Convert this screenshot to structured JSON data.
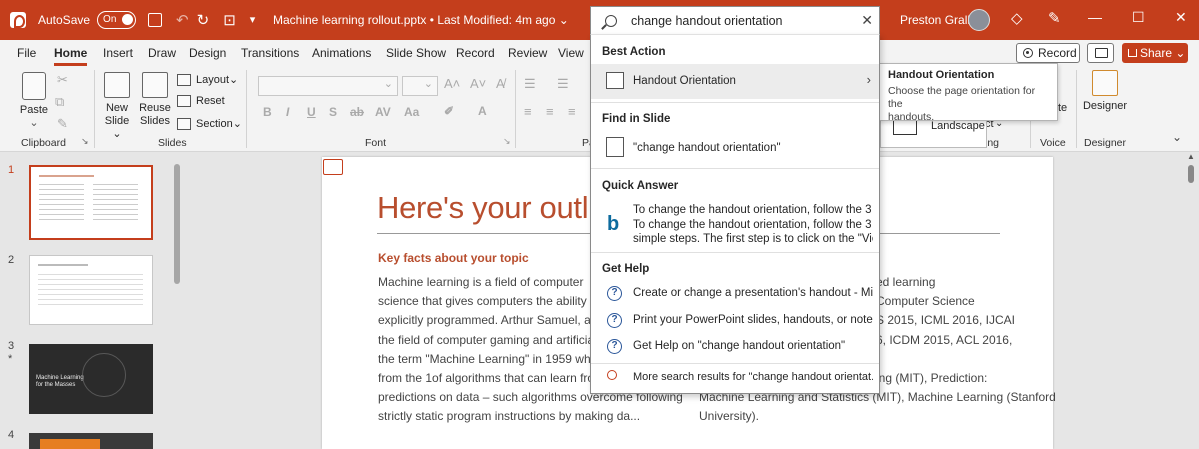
{
  "titlebar": {
    "autosave_label": "AutoSave",
    "autosave_state": "On",
    "filename": "Machine learning rollout.pptx",
    "modified": "Last Modified: 4m ago",
    "user": "Preston Gralla",
    "bg_color": "#c43e1c"
  },
  "search": {
    "query": "change handout orientation"
  },
  "menu_tabs": [
    "File",
    "Home",
    "Insert",
    "Draw",
    "Design",
    "Transitions",
    "Animations",
    "Slide Show",
    "Record",
    "Review",
    "View"
  ],
  "active_tab": "Home",
  "header_buttons": {
    "record": "Record",
    "share": "Share"
  },
  "ribbon": {
    "clipboard": {
      "paste": "Paste",
      "label": "Clipboard"
    },
    "slides": {
      "new_slide_1": "New",
      "new_slide_2": "Slide",
      "reuse_1": "Reuse",
      "reuse_2": "Slides",
      "layout": "Layout",
      "reset": "Reset",
      "section": "Section",
      "label": "Slides"
    },
    "font": {
      "label": "Font"
    },
    "partial_label": "Pa",
    "landscape": "Landscape",
    "partial_button": "te",
    "partial_right": "ct",
    "partial_group": "ing",
    "voice": {
      "label": "Voice"
    },
    "designer": {
      "button": "Designer",
      "label": "Designer"
    }
  },
  "tooltip": {
    "title": "Handout Orientation",
    "description_1": "Choose the page orientation for the",
    "description_2": "handouts."
  },
  "dropdown": {
    "best_action_header": "Best Action",
    "best_action_item": "Handout Orientation",
    "find_header": "Find in Slide",
    "find_item": "\"change handout orientation\"",
    "quick_answer_header": "Quick Answer",
    "quick_answer_line1": "To change the handout orientation, follow the 3 ...",
    "quick_answer_line2": "To change the handout orientation, follow the 3",
    "quick_answer_line3": "simple steps. The first step is to click on the \"Vie...",
    "help_header": "Get Help",
    "help_items": [
      "Create or change a presentation's handout - Micr...",
      "Print your PowerPoint slides, handouts, or notes",
      "Get Help on \"change handout orientation\""
    ],
    "more_results": "More search results for \"change handout orientat..."
  },
  "thumbnails": [
    {
      "number": "1",
      "selected": true
    },
    {
      "number": "2",
      "selected": false
    },
    {
      "number": "3",
      "selected": false,
      "mark": "*"
    },
    {
      "number": "4",
      "selected": false
    }
  ],
  "slide": {
    "title": "Here's your outline",
    "subtitle": "Key facts about your topic",
    "left_lines": [
      "Machine learning is a field of computer",
      "science that gives computers the ability to lear",
      "explicitly programmed. Arthur Samuel, an Ame",
      "the field of computer gaming and artificial inte",
      "the term \"Machine Learning\" in 1959 while at I",
      "from the 1of algorithms that can learn from an",
      "predictions on data – such algorithms overcome following",
      "strictly static program instructions by making da..."
    ],
    "right_lines": [
      "ed learning",
      "Computer Science",
      "S 2015, ICML 2016, IJCAI",
      "6, ICDM 2015, ACL 2016,",
      "",
      "ing (MIT), Prediction:",
      "Machine Learning and Statistics (MIT), Machine Learning (Stanford",
      "University)."
    ],
    "accent_color": "#b84e2e"
  },
  "thumb3_title": "Machine Learning for the Masses"
}
